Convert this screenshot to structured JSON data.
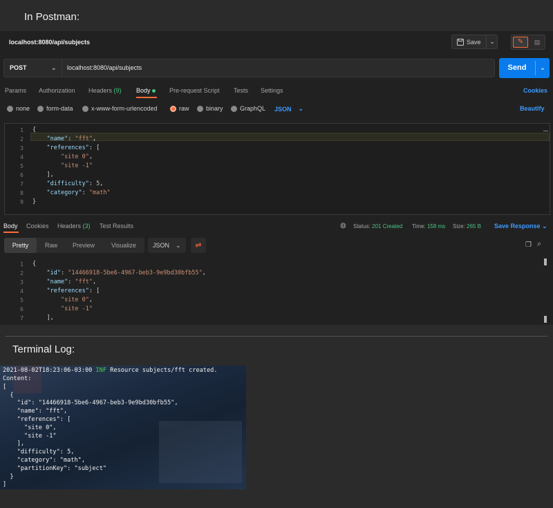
{
  "headings": {
    "postman": "In Postman:",
    "terminal": "Terminal Log:"
  },
  "request_tab": {
    "title": "localhost:8080/api/subjects",
    "save_label": "Save"
  },
  "request": {
    "method": "POST",
    "url": "localhost:8080/api/subjects",
    "send_label": "Send"
  },
  "req_tabs": {
    "params": "Params",
    "authorization": "Authorization",
    "headers": "Headers",
    "headers_count": "(9)",
    "body": "Body",
    "prerequest": "Pre-request Script",
    "tests": "Tests",
    "settings": "Settings",
    "cookies": "Cookies"
  },
  "body_types": {
    "none": "none",
    "form_data": "form-data",
    "urlencoded": "x-www-form-urlencoded",
    "raw": "raw",
    "binary": "binary",
    "graphql": "GraphQL",
    "format": "JSON",
    "beautify": "Beautify"
  },
  "request_body": {
    "line_numbers": [
      "1",
      "2",
      "3",
      "4",
      "5",
      "6",
      "7",
      "8",
      "9"
    ],
    "lines": [
      "{",
      "    \"name\": \"fft\",",
      "    \"references\": [",
      "        \"site 0\",",
      "        \"site -1\"",
      "    ],",
      "    \"difficulty\": 5,",
      "    \"category\": \"math\"",
      "}"
    ]
  },
  "response_tabs": {
    "body": "Body",
    "cookies": "Cookies",
    "headers": "Headers",
    "headers_count": "(3)",
    "test_results": "Test Results",
    "status_label": "Status:",
    "status_value": "201 Created",
    "time_label": "Time:",
    "time_value": "158 ms",
    "size_label": "Size:",
    "size_value": "265 B",
    "save_response": "Save Response"
  },
  "response_view": {
    "pretty": "Pretty",
    "raw": "Raw",
    "preview": "Preview",
    "visualize": "Visualize",
    "format": "JSON"
  },
  "response_body": {
    "line_numbers": [
      "1",
      "2",
      "3",
      "4",
      "5",
      "6",
      "7"
    ],
    "lines": [
      "{",
      "    \"id\": \"14466918-5be6-4967-beb3-9e9bd30bfb55\",",
      "    \"name\": \"fft\",",
      "    \"references\": [",
      "        \"site 0\",",
      "        \"site -1\"",
      "    ],"
    ]
  },
  "terminal": {
    "timestamp": "2021-08-02T18:23:06-03:00",
    "level": "INF",
    "message": "Resource subjects/fft created.",
    "lines": [
      "Content:",
      "[",
      "  {",
      "    \"id\": \"14466918-5be6-4967-beb3-9e9bd30bfb55\",",
      "    \"name\": \"fft\",",
      "    \"references\": [",
      "      \"site 0\",",
      "      \"site -1\"",
      "    ],",
      "    \"difficulty\": 5,",
      "    \"category\": \"math\",",
      "    \"partitionKey\": \"subject\"",
      "  }",
      "]"
    ]
  },
  "colors": {
    "accent": "#ff6c37",
    "send": "#097bed",
    "status_ok": "#49c580",
    "link": "#3d9bff"
  }
}
